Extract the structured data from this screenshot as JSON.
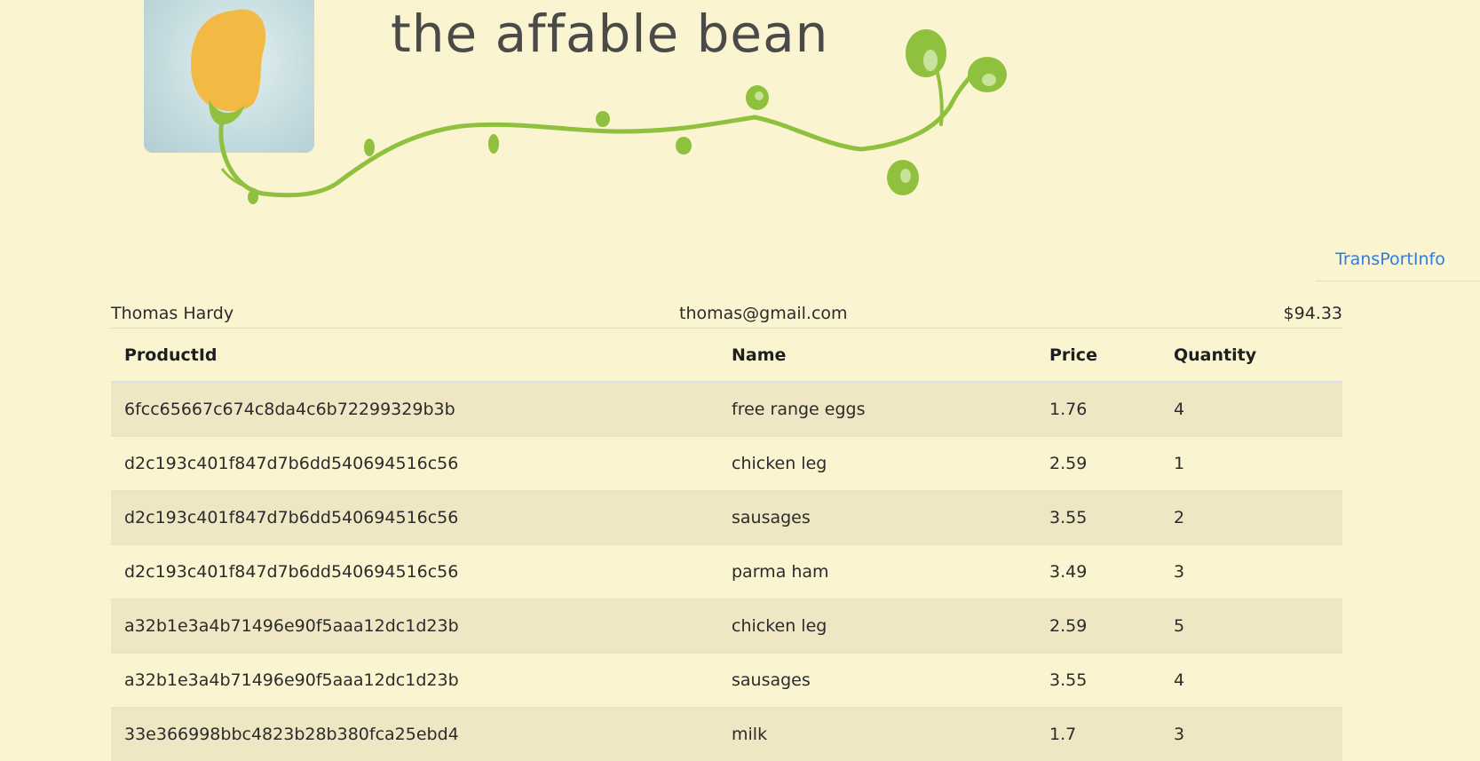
{
  "header": {
    "brand_title": "the affable bean",
    "colors": {
      "background": "#faf4d1",
      "bean": "#f2b945",
      "vine": "#8fc13e",
      "link": "#2f7de1"
    }
  },
  "nav": {
    "transport_link": "TransPortInfo"
  },
  "order": {
    "customer_name": "Thomas Hardy",
    "email": "thomas@gmail.com",
    "total": "$94.33"
  },
  "table": {
    "headers": [
      "ProductId",
      "Name",
      "Price",
      "Quantity"
    ],
    "rows": [
      [
        "6fcc65667c674c8da4c6b72299329b3b",
        "free range eggs",
        "1.76",
        "4"
      ],
      [
        "d2c193c401f847d7b6dd540694516c56",
        "chicken leg",
        "2.59",
        "1"
      ],
      [
        "d2c193c401f847d7b6dd540694516c56",
        "sausages",
        "3.55",
        "2"
      ],
      [
        "d2c193c401f847d7b6dd540694516c56",
        "parma ham",
        "3.49",
        "3"
      ],
      [
        "a32b1e3a4b71496e90f5aaa12dc1d23b",
        "chicken leg",
        "2.59",
        "5"
      ],
      [
        "a32b1e3a4b71496e90f5aaa12dc1d23b",
        "sausages",
        "3.55",
        "4"
      ],
      [
        "33e366998bbc4823b28b380fca25ebd4",
        "milk",
        "1.7",
        "3"
      ]
    ]
  }
}
